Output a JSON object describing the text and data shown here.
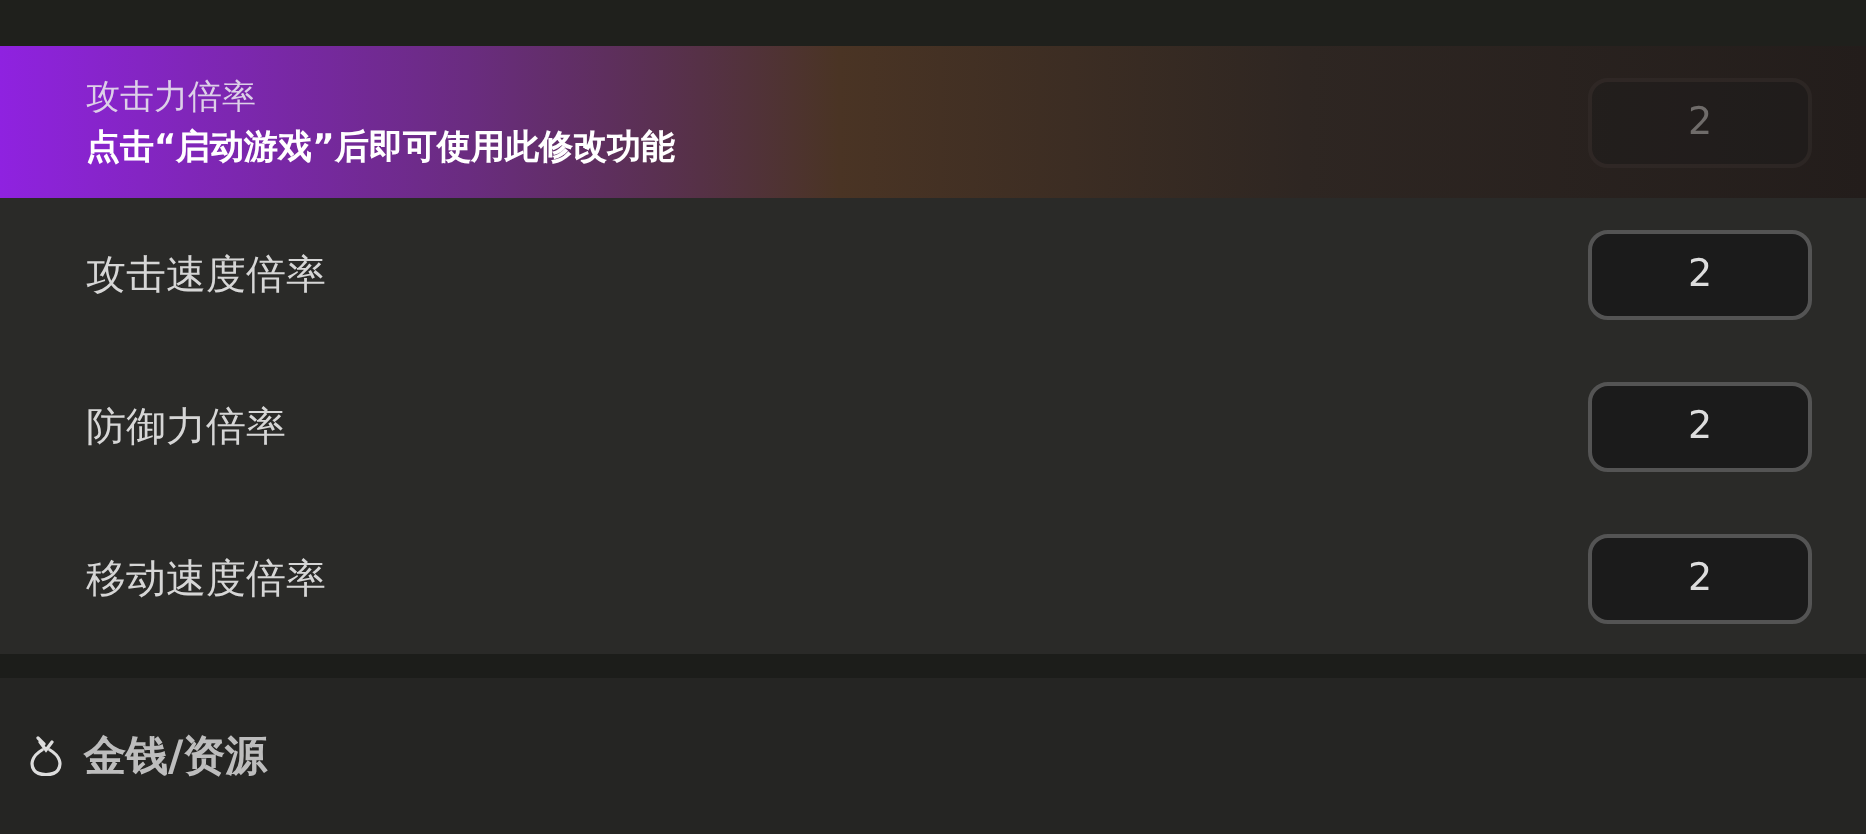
{
  "rows": [
    {
      "label": "攻击力倍率",
      "value": "2",
      "locked": true,
      "notice": "点击“启动游戏”后即可使用此修改功能"
    },
    {
      "label": "攻击速度倍率",
      "value": "2",
      "locked": false
    },
    {
      "label": "防御力倍率",
      "value": "2",
      "locked": false
    },
    {
      "label": "移动速度倍率",
      "value": "2",
      "locked": false
    }
  ],
  "section": {
    "title": "金钱/资源"
  }
}
